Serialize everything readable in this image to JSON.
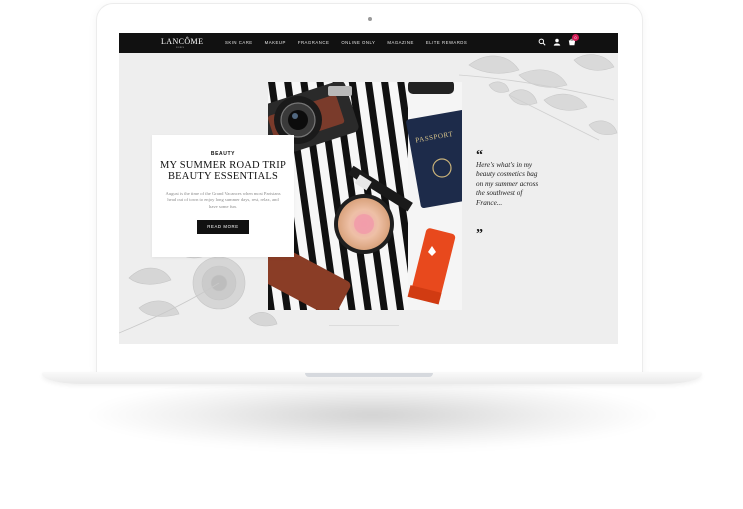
{
  "nav": {
    "logo": "LANCÔME",
    "logo_sub": "PARIS",
    "menu": [
      "SKIN CARE",
      "MAKEUP",
      "FRAGRANCE",
      "ONLINE ONLY",
      "MAGAZINE",
      "ELITE REWARDS"
    ],
    "cart_count": "0",
    "icons": [
      "search-icon",
      "user-icon",
      "cart-icon"
    ]
  },
  "article": {
    "category": "BEAUTY",
    "title": "MY SUMMER ROAD TRIP BEAUTY ESSENTIALS",
    "excerpt": "August is the time of the Grand Vacances when most Parisians head out of town to enjoy long summer days, rest, relax, and have some fun.",
    "button": "READ MORE"
  },
  "quote": {
    "open": "“",
    "text": "Here's what's in my beauty cosmetics bag on my summer across the southwest of France...",
    "close": "”"
  },
  "photo": {
    "passport_label": "PASSPORT"
  },
  "colors": {
    "nav_bg": "#111111",
    "screen_bg": "#eeeeee",
    "badge": "#d21e57",
    "button_bg": "#111111"
  }
}
